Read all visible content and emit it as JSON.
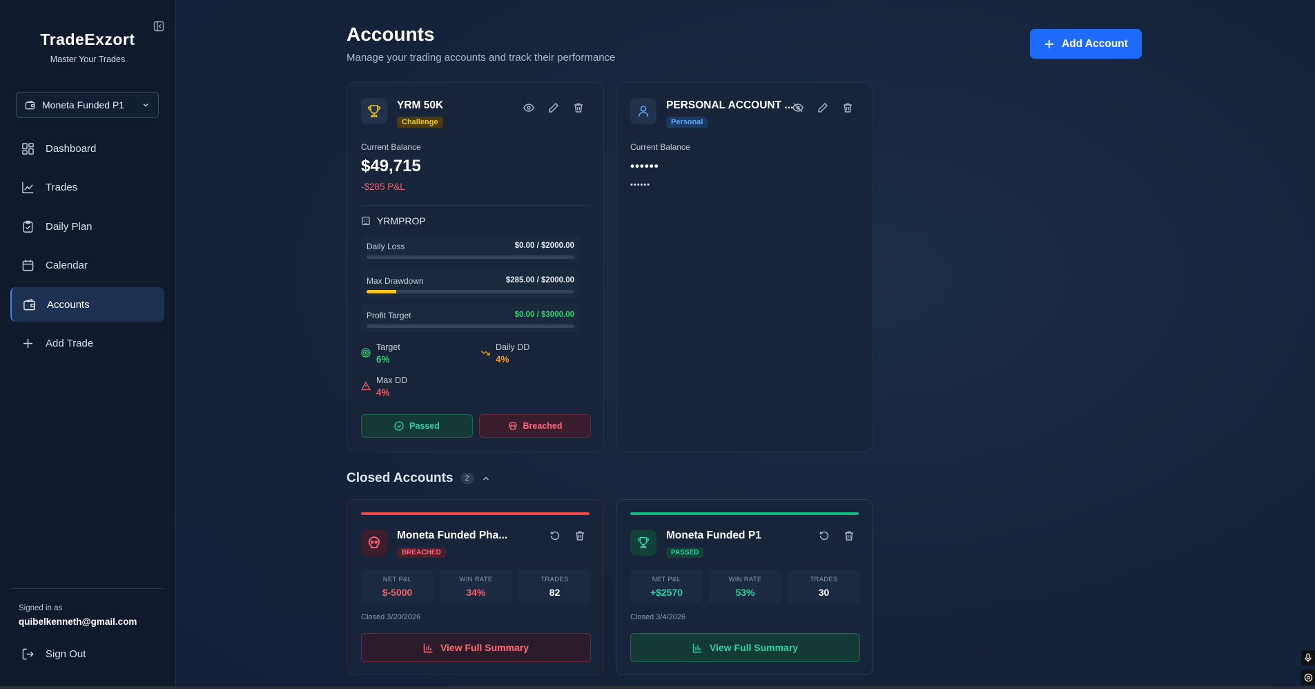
{
  "brand": {
    "title": "TradeExzort",
    "subtitle": "Master Your Trades"
  },
  "account_selector": {
    "value": "Moneta Funded P1"
  },
  "nav": [
    {
      "label": "Dashboard",
      "icon": "dashboard-icon"
    },
    {
      "label": "Trades",
      "icon": "trending-chart-icon"
    },
    {
      "label": "Daily Plan",
      "icon": "clipboard-check-icon"
    },
    {
      "label": "Calendar",
      "icon": "calendar-icon"
    },
    {
      "label": "Accounts",
      "icon": "wallet-icon",
      "active": true
    },
    {
      "label": "Add Trade",
      "icon": "plus-icon"
    }
  ],
  "user": {
    "signed_label": "Signed in as",
    "email": "quibelkenneth@gmail.com",
    "signout": "Sign Out"
  },
  "header": {
    "title": "Accounts",
    "subtitle": "Manage your trading accounts and track their performance",
    "add_button": "Add Account"
  },
  "active_accounts": [
    {
      "name": "YRM 50K",
      "badge": "Challenge",
      "balance_label": "Current Balance",
      "balance": "$49,715",
      "pnl": "-$285 P&L",
      "firm": "YRMPROP",
      "metrics": [
        {
          "label": "Daily Loss",
          "value": "$0.00 / $2000.00",
          "progress": 0
        },
        {
          "label": "Max Drawdown",
          "value": "$285.00 / $2000.00",
          "progress": 0.1425
        },
        {
          "label": "Profit Target",
          "value": "$0.00 / $3000.00",
          "progress": 0
        }
      ],
      "rules": [
        {
          "label": "Target",
          "value": "6%"
        },
        {
          "label": "Daily DD",
          "value": "4%"
        },
        {
          "label": "Max DD",
          "value": "4%"
        }
      ],
      "passed_button": "Passed",
      "breached_button": "Breached"
    },
    {
      "name": "PERSONAL ACCOUNT ...",
      "badge": "Personal",
      "balance_label": "Current Balance",
      "balance": "••••••",
      "pnl": "••••••"
    }
  ],
  "closed_section": {
    "title": "Closed Accounts",
    "count": "2"
  },
  "closed_accounts": [
    {
      "name": "Moneta Funded Pha...",
      "status": "BREACHED",
      "stats": [
        {
          "label": "NET P&L",
          "value": "$-5000"
        },
        {
          "label": "WIN RATE",
          "value": "34%"
        },
        {
          "label": "TRADES",
          "value": "82"
        }
      ],
      "closed_on": "Closed 3/20/2026",
      "summary_button": "View Full Summary"
    },
    {
      "name": "Moneta Funded P1",
      "status": "PASSED",
      "stats": [
        {
          "label": "NET P&L",
          "value": "+$2570"
        },
        {
          "label": "WIN RATE",
          "value": "53%"
        },
        {
          "label": "TRADES",
          "value": "30"
        }
      ],
      "closed_on": "Closed 3/4/2026",
      "summary_button": "View Full Summary"
    }
  ],
  "colors": {
    "accent": "#1f6bff",
    "success": "#2dd4a0",
    "danger": "#ff6b7a",
    "warning": "#f5c518"
  }
}
